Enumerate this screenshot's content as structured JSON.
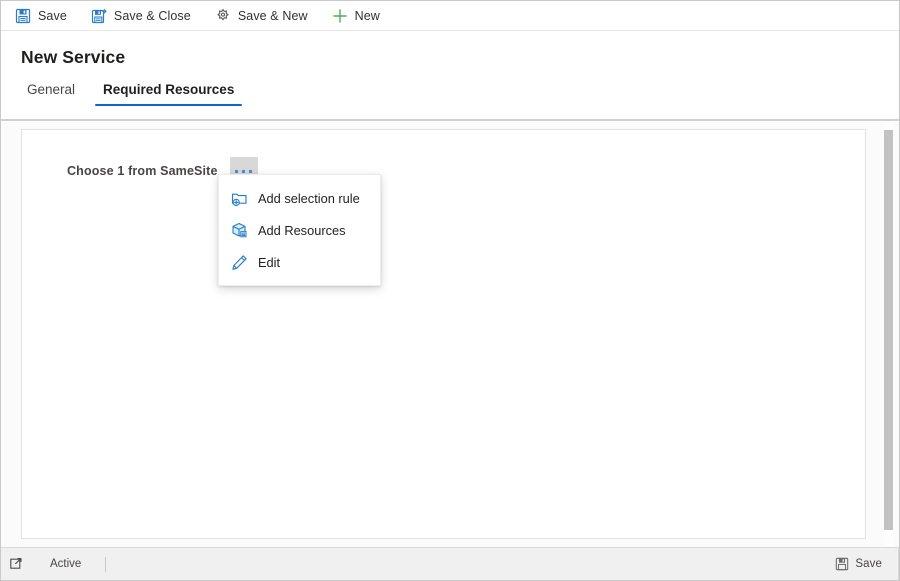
{
  "window": {
    "accent_blue": "#0b68c8",
    "icon_blue": "#2a7cc7",
    "icon_green": "#4caf50",
    "icon_gray": "#5a5a5a"
  },
  "command_bar": {
    "buttons": [
      {
        "label": "Save",
        "icon": "save-floppy-icon"
      },
      {
        "label": "Save & Close",
        "icon": "save-and-close-icon"
      },
      {
        "label": "Save & New",
        "icon": "save-and-new-icon"
      },
      {
        "label": "New",
        "icon": "plus-icon"
      }
    ]
  },
  "header": {
    "title": "New Service",
    "tabs": [
      {
        "label": "General",
        "active": false
      },
      {
        "label": "Required Resources",
        "active": true
      }
    ]
  },
  "canvas": {
    "section_label": "Choose 1 from SameSite",
    "ellipsis_button": "more-commands-button"
  },
  "context_menu": {
    "items": [
      {
        "label": "Add selection rule",
        "icon": "folder-add-icon"
      },
      {
        "label": "Add Resources",
        "icon": "cube-package-icon"
      },
      {
        "label": "Edit",
        "icon": "pencil-edit-icon"
      }
    ]
  },
  "footer": {
    "expand_icon": "popout-expand-icon",
    "status": "Active",
    "save_label": "Save",
    "save_icon": "save-floppy-icon"
  }
}
